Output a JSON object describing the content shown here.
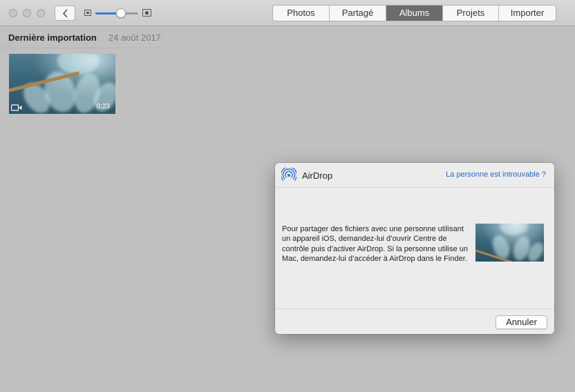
{
  "toolbar": {
    "tabs": [
      {
        "label": "Photos",
        "active": false
      },
      {
        "label": "Partagé",
        "active": false
      },
      {
        "label": "Albums",
        "active": true
      },
      {
        "label": "Projets",
        "active": false
      },
      {
        "label": "Importer",
        "active": false
      }
    ],
    "zoom_level": 0.6
  },
  "header": {
    "title": "Dernière importation",
    "date": "24 août 2017"
  },
  "thumbnail": {
    "duration": "0:23"
  },
  "dialog": {
    "title": "AirDrop",
    "help_link": "La personne est introuvable ?",
    "message": "Pour partager des fichiers avec une personne utilisant un appareil iOS, demandez-lui d’ouvrir Centre de contrôle puis d’activer AirDrop. Si la personne utilise un Mac, demandez-lui d’accéder à AirDrop dans le Finder.",
    "cancel_label": "Annuler"
  },
  "colors": {
    "accent": "#3a78d8",
    "link": "#2767c4",
    "active_tab": "#6b6b6b"
  }
}
